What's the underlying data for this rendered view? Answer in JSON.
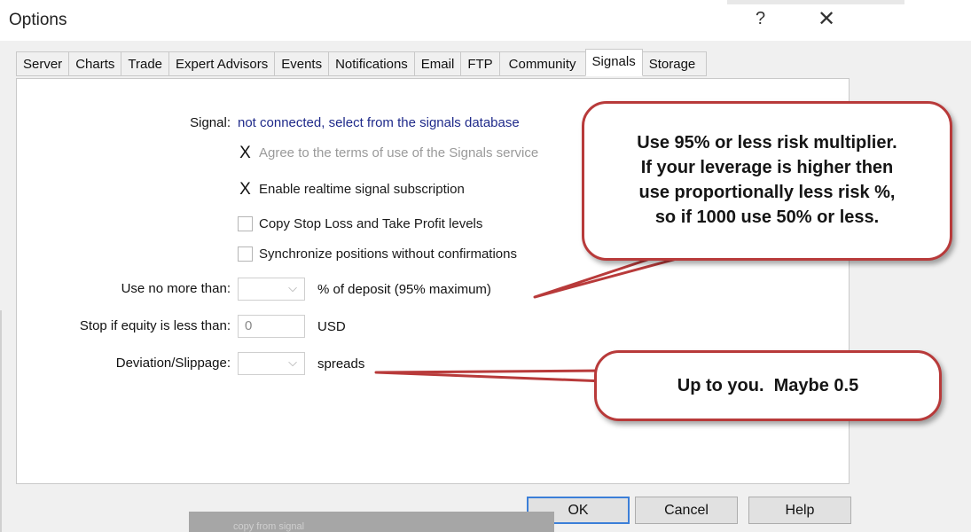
{
  "window": {
    "title": "Options",
    "help_glyph": "?",
    "close_glyph": "✕"
  },
  "tabs": [
    {
      "label": "Server",
      "active": false
    },
    {
      "label": "Charts",
      "active": false
    },
    {
      "label": "Trade",
      "active": false
    },
    {
      "label": "Expert Advisors",
      "active": false
    },
    {
      "label": "Events",
      "active": false
    },
    {
      "label": "Notifications",
      "active": false
    },
    {
      "label": "Email",
      "active": false
    },
    {
      "label": "FTP",
      "active": false
    },
    {
      "label": "Community",
      "active": false
    },
    {
      "label": "Signals",
      "active": true
    },
    {
      "label": "Storage",
      "active": false
    }
  ],
  "signals": {
    "signal_label": "Signal:",
    "signal_status": "not connected, select from the signals database",
    "checkboxes": [
      {
        "label": "Agree to the terms of use of the Signals service",
        "checked": true,
        "disabled": true,
        "mark": "X"
      },
      {
        "label": "Enable realtime signal subscription",
        "checked": true,
        "disabled": false,
        "mark": "X"
      },
      {
        "label": "Copy Stop Loss and Take Profit levels",
        "checked": false,
        "disabled": false,
        "mark": ""
      },
      {
        "label": "Synchronize positions without confirmations",
        "checked": false,
        "disabled": false,
        "mark": ""
      }
    ],
    "use_no_more_label": "Use no more than:",
    "use_no_more_unit": "% of deposit (95% maximum)",
    "stop_equity_label": "Stop if equity is less than:",
    "stop_equity_value": "0",
    "stop_equity_unit": "USD",
    "deviation_label": "Deviation/Slippage:",
    "deviation_unit": "spreads",
    "dropdown_glyph": "⌵"
  },
  "buttons": {
    "ok": "OK",
    "cancel": "Cancel",
    "help": "Help"
  },
  "callouts": {
    "risk_lines": [
      "Use 95% or less risk multiplier.",
      "If your leverage is higher then",
      "use proportionally less risk %,",
      "so if 1000 use 50% or less."
    ],
    "slippage": "Up to you.  Maybe 0.5"
  },
  "background_ghost_text": "copy from signal",
  "colors": {
    "accent": "#3c7fd8",
    "callout_border": "#b83a3a",
    "link_text": "#1f2a8a"
  }
}
